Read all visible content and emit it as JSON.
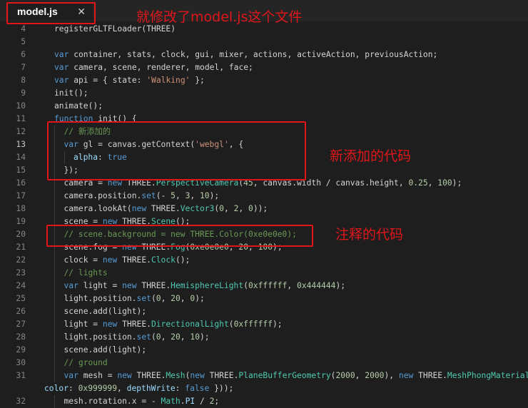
{
  "tab": {
    "filename": "model.js",
    "close_symbol": "✕"
  },
  "annotations": {
    "title": "就修改了model.js这个文件",
    "added": "新添加的代码",
    "commented": "注释的代码"
  },
  "lines": [
    {
      "num": "4",
      "active": false,
      "indent": 1,
      "tokens": [
        {
          "t": "registerGLTFLoader(THREE)",
          "c": ""
        }
      ]
    },
    {
      "num": "5",
      "active": false,
      "indent": 0,
      "tokens": []
    },
    {
      "num": "6",
      "active": false,
      "indent": 1,
      "tokens": [
        {
          "t": "var",
          "c": "k"
        },
        {
          "t": " container, stats, clock, gui, mixer, actions, activeAction, previousAction;",
          "c": ""
        }
      ]
    },
    {
      "num": "7",
      "active": false,
      "indent": 1,
      "tokens": [
        {
          "t": "var",
          "c": "k"
        },
        {
          "t": " camera, scene, renderer, model, face;",
          "c": ""
        }
      ]
    },
    {
      "num": "8",
      "active": false,
      "indent": 1,
      "tokens": [
        {
          "t": "var",
          "c": "k"
        },
        {
          "t": " api = { state: ",
          "c": ""
        },
        {
          "t": "'Walking'",
          "c": "s"
        },
        {
          "t": " };",
          "c": ""
        }
      ]
    },
    {
      "num": "9",
      "active": false,
      "indent": 1,
      "tokens": [
        {
          "t": "init();",
          "c": ""
        }
      ]
    },
    {
      "num": "10",
      "active": false,
      "indent": 1,
      "tokens": [
        {
          "t": "animate();",
          "c": ""
        }
      ]
    },
    {
      "num": "11",
      "active": false,
      "indent": 1,
      "tokens": [
        {
          "t": "function",
          "c": "k"
        },
        {
          "t": " init() {",
          "c": ""
        }
      ]
    },
    {
      "num": "12",
      "active": false,
      "indent": 2,
      "tokens": [
        {
          "t": "// 新添加的",
          "c": "c"
        }
      ]
    },
    {
      "num": "13",
      "active": true,
      "indent": 2,
      "tokens": [
        {
          "t": "var",
          "c": "k"
        },
        {
          "t": " gl = canvas.getContext(",
          "c": ""
        },
        {
          "t": "'webgl'",
          "c": "s"
        },
        {
          "t": ", {",
          "c": ""
        }
      ]
    },
    {
      "num": "14",
      "active": false,
      "indent": 3,
      "tokens": [
        {
          "t": "alpha",
          "c": "p"
        },
        {
          "t": ": ",
          "c": ""
        },
        {
          "t": "true",
          "c": "k"
        }
      ]
    },
    {
      "num": "15",
      "active": false,
      "indent": 2,
      "tokens": [
        {
          "t": "});",
          "c": ""
        }
      ]
    },
    {
      "num": "16",
      "active": false,
      "indent": 2,
      "tokens": [
        {
          "t": "camera = ",
          "c": ""
        },
        {
          "t": "new",
          "c": "k"
        },
        {
          "t": " THREE.",
          "c": ""
        },
        {
          "t": "PerspectiveCamera",
          "c": "t"
        },
        {
          "t": "(",
          "c": ""
        },
        {
          "t": "45",
          "c": "n"
        },
        {
          "t": ", canvas.width / canvas.height, ",
          "c": ""
        },
        {
          "t": "0.25",
          "c": "n"
        },
        {
          "t": ", ",
          "c": ""
        },
        {
          "t": "100",
          "c": "n"
        },
        {
          "t": ");",
          "c": ""
        }
      ]
    },
    {
      "num": "17",
      "active": false,
      "indent": 2,
      "tokens": [
        {
          "t": "camera.position.",
          "c": ""
        },
        {
          "t": "set",
          "c": "k"
        },
        {
          "t": "(- ",
          "c": ""
        },
        {
          "t": "5",
          "c": "n"
        },
        {
          "t": ", ",
          "c": ""
        },
        {
          "t": "3",
          "c": "n"
        },
        {
          "t": ", ",
          "c": ""
        },
        {
          "t": "10",
          "c": "n"
        },
        {
          "t": ");",
          "c": ""
        }
      ]
    },
    {
      "num": "18",
      "active": false,
      "indent": 2,
      "tokens": [
        {
          "t": "camera.lookAt(",
          "c": ""
        },
        {
          "t": "new",
          "c": "k"
        },
        {
          "t": " THREE.",
          "c": ""
        },
        {
          "t": "Vector3",
          "c": "t"
        },
        {
          "t": "(",
          "c": ""
        },
        {
          "t": "0",
          "c": "n"
        },
        {
          "t": ", ",
          "c": ""
        },
        {
          "t": "2",
          "c": "n"
        },
        {
          "t": ", ",
          "c": ""
        },
        {
          "t": "0",
          "c": "n"
        },
        {
          "t": "));",
          "c": ""
        }
      ]
    },
    {
      "num": "19",
      "active": false,
      "indent": 2,
      "tokens": [
        {
          "t": "scene = ",
          "c": ""
        },
        {
          "t": "new",
          "c": "k"
        },
        {
          "t": " THREE.",
          "c": ""
        },
        {
          "t": "Scene",
          "c": "t"
        },
        {
          "t": "();",
          "c": ""
        }
      ]
    },
    {
      "num": "20",
      "active": false,
      "indent": 2,
      "tokens": [
        {
          "t": "// scene.background = new THREE.Color(0xe0e0e0);",
          "c": "c"
        }
      ]
    },
    {
      "num": "21",
      "active": false,
      "indent": 2,
      "tokens": [
        {
          "t": "scene.fog = ",
          "c": ""
        },
        {
          "t": "new",
          "c": "k"
        },
        {
          "t": " THREE.",
          "c": ""
        },
        {
          "t": "Fog",
          "c": "t"
        },
        {
          "t": "(",
          "c": ""
        },
        {
          "t": "0xe0e0e0",
          "c": "n"
        },
        {
          "t": ", ",
          "c": ""
        },
        {
          "t": "20",
          "c": "n"
        },
        {
          "t": ", ",
          "c": ""
        },
        {
          "t": "100",
          "c": "n"
        },
        {
          "t": ");",
          "c": ""
        }
      ]
    },
    {
      "num": "22",
      "active": false,
      "indent": 2,
      "tokens": [
        {
          "t": "clock = ",
          "c": ""
        },
        {
          "t": "new",
          "c": "k"
        },
        {
          "t": " THREE.",
          "c": ""
        },
        {
          "t": "Clock",
          "c": "t"
        },
        {
          "t": "();",
          "c": ""
        }
      ]
    },
    {
      "num": "23",
      "active": false,
      "indent": 2,
      "tokens": [
        {
          "t": "// lights",
          "c": "c"
        }
      ]
    },
    {
      "num": "24",
      "active": false,
      "indent": 2,
      "tokens": [
        {
          "t": "var",
          "c": "k"
        },
        {
          "t": " light = ",
          "c": ""
        },
        {
          "t": "new",
          "c": "k"
        },
        {
          "t": " THREE.",
          "c": ""
        },
        {
          "t": "HemisphereLight",
          "c": "t"
        },
        {
          "t": "(",
          "c": ""
        },
        {
          "t": "0xffffff",
          "c": "n"
        },
        {
          "t": ", ",
          "c": ""
        },
        {
          "t": "0x444444",
          "c": "n"
        },
        {
          "t": ");",
          "c": ""
        }
      ]
    },
    {
      "num": "25",
      "active": false,
      "indent": 2,
      "tokens": [
        {
          "t": "light.position.",
          "c": ""
        },
        {
          "t": "set",
          "c": "k"
        },
        {
          "t": "(",
          "c": ""
        },
        {
          "t": "0",
          "c": "n"
        },
        {
          "t": ", ",
          "c": ""
        },
        {
          "t": "20",
          "c": "n"
        },
        {
          "t": ", ",
          "c": ""
        },
        {
          "t": "0",
          "c": "n"
        },
        {
          "t": ");",
          "c": ""
        }
      ]
    },
    {
      "num": "26",
      "active": false,
      "indent": 2,
      "tokens": [
        {
          "t": "scene.add(light);",
          "c": ""
        }
      ]
    },
    {
      "num": "27",
      "active": false,
      "indent": 2,
      "tokens": [
        {
          "t": "light = ",
          "c": ""
        },
        {
          "t": "new",
          "c": "k"
        },
        {
          "t": " THREE.",
          "c": ""
        },
        {
          "t": "DirectionalLight",
          "c": "t"
        },
        {
          "t": "(",
          "c": ""
        },
        {
          "t": "0xffffff",
          "c": "n"
        },
        {
          "t": ");",
          "c": ""
        }
      ]
    },
    {
      "num": "28",
      "active": false,
      "indent": 2,
      "tokens": [
        {
          "t": "light.position.",
          "c": ""
        },
        {
          "t": "set",
          "c": "k"
        },
        {
          "t": "(",
          "c": ""
        },
        {
          "t": "0",
          "c": "n"
        },
        {
          "t": ", ",
          "c": ""
        },
        {
          "t": "20",
          "c": "n"
        },
        {
          "t": ", ",
          "c": ""
        },
        {
          "t": "10",
          "c": "n"
        },
        {
          "t": ");",
          "c": ""
        }
      ]
    },
    {
      "num": "29",
      "active": false,
      "indent": 2,
      "tokens": [
        {
          "t": "scene.add(light);",
          "c": ""
        }
      ]
    },
    {
      "num": "30",
      "active": false,
      "indent": 2,
      "tokens": [
        {
          "t": "// ground",
          "c": "c"
        }
      ]
    },
    {
      "num": "31",
      "active": false,
      "indent": 2,
      "tokens": [
        {
          "t": "var",
          "c": "k"
        },
        {
          "t": " mesh = ",
          "c": ""
        },
        {
          "t": "new",
          "c": "k"
        },
        {
          "t": " THREE.",
          "c": ""
        },
        {
          "t": "Mesh",
          "c": "t"
        },
        {
          "t": "(",
          "c": ""
        },
        {
          "t": "new",
          "c": "k"
        },
        {
          "t": " THREE.",
          "c": ""
        },
        {
          "t": "PlaneBufferGeometry",
          "c": "t"
        },
        {
          "t": "(",
          "c": ""
        },
        {
          "t": "2000",
          "c": "n"
        },
        {
          "t": ", ",
          "c": ""
        },
        {
          "t": "2000",
          "c": "n"
        },
        {
          "t": "), ",
          "c": ""
        },
        {
          "t": "new",
          "c": "k"
        },
        {
          "t": " THREE.",
          "c": ""
        },
        {
          "t": "MeshPhongMaterial",
          "c": "t"
        },
        {
          "t": "({",
          "c": ""
        }
      ]
    },
    {
      "num": "",
      "active": false,
      "indent": 0,
      "wrap": true,
      "tokens": [
        {
          "t": "color",
          "c": "p"
        },
        {
          "t": ": ",
          "c": ""
        },
        {
          "t": "0x999999",
          "c": "n"
        },
        {
          "t": ", ",
          "c": ""
        },
        {
          "t": "depthWrite",
          "c": "p"
        },
        {
          "t": ": ",
          "c": ""
        },
        {
          "t": "false",
          "c": "k"
        },
        {
          "t": " }));",
          "c": ""
        }
      ]
    },
    {
      "num": "32",
      "active": false,
      "indent": 2,
      "tokens": [
        {
          "t": "mesh.rotation.x = - ",
          "c": ""
        },
        {
          "t": "Math",
          "c": "t"
        },
        {
          "t": ".",
          "c": ""
        },
        {
          "t": "PI",
          "c": "p"
        },
        {
          "t": " / ",
          "c": ""
        },
        {
          "t": "2",
          "c": "n"
        },
        {
          "t": ";",
          "c": ""
        }
      ]
    }
  ]
}
